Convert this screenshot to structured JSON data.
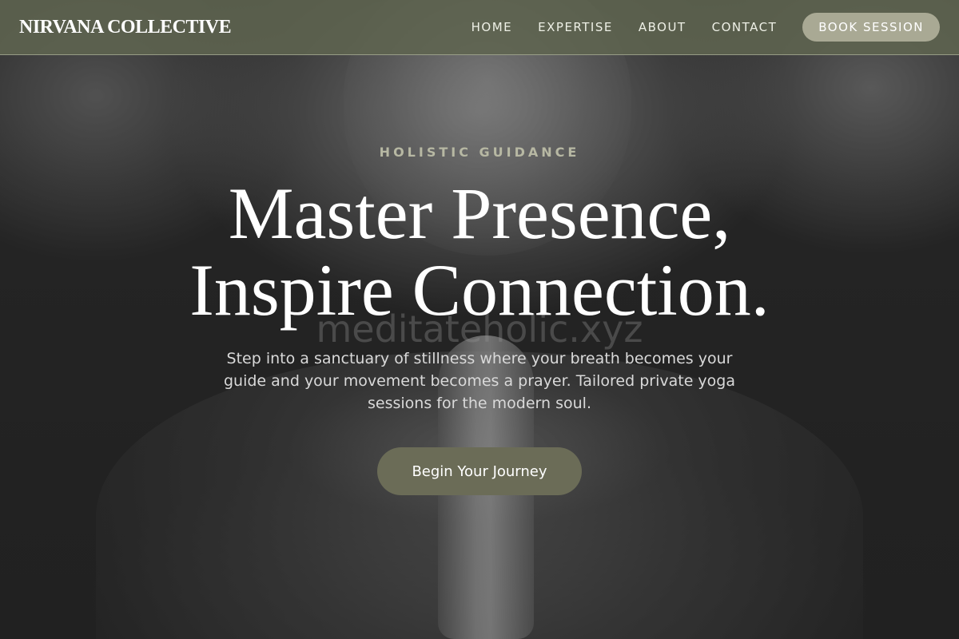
{
  "header": {
    "logo": "NIRVANA COLLECTIVE",
    "nav": [
      {
        "label": "HOME"
      },
      {
        "label": "EXPERTISE"
      },
      {
        "label": "ABOUT"
      },
      {
        "label": "CONTACT"
      }
    ],
    "cta_label": "BOOK SESSION"
  },
  "hero": {
    "eyebrow": "HOLISTIC GUIDANCE",
    "title_line1": "Master Presence,",
    "title_line2": "Inspire Connection.",
    "watermark": "meditateholic.xyz",
    "subtitle": "Step into a sanctuary of stillness where your breath becomes your guide and your movement becomes a prayer. Tailored private yoga sessions for the modern soul.",
    "cta_label": "Begin Your Journey"
  },
  "colors": {
    "header_bg": "#5f6450",
    "accent": "#6b6c57",
    "cta_light": "#a9a994",
    "eyebrow": "#b7b8a3"
  }
}
